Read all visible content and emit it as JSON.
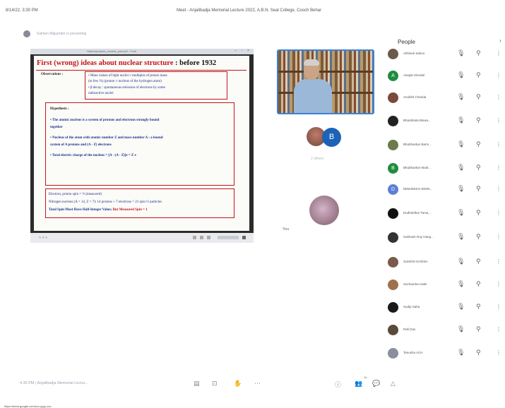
{
  "print_header": {
    "date": "8/14/22, 3:30 PM",
    "title": "Meet - Anjalibadja Memorial Lecture 2022, A.B.N. Seal College, Cooch Behar"
  },
  "presenter": {
    "label": "Sukhen Majumder is presenting"
  },
  "slide_window": {
    "titlebar": "Hadronphysics_nuclear_part.pdf - Foxit",
    "heading_red": "First (wrong) ideas about nuclear structure",
    "heading_dark": " : before 1932",
    "observations_label": "Observations :",
    "observations": [
      "• Mass values of light nuclei ≈ multiples of proton mass",
      "  (to few %)  (proton ≡ nucleus of the hydrogen atom)",
      "• β decay : spontaneous emission of electrons by some",
      "  radioactive nuclei"
    ],
    "hypothesis_label": "Hypothesis :",
    "hypothesis": [
      "• The atomic nucleus is a system of protons and electrons strongly bound",
      "  together",
      "• Nucleus of the atom with atomic number Z and mass number A : a bound",
      "  system of A protons and (A - Z) electrons",
      "• Total electric charge of the nucleus = [A - (A - Z)]e = Z e"
    ],
    "spin_lines": [
      "Electron, proton spin = ½ (measured)",
      "Nitrogen nucleus (A = 14, Z = 7): 14 protons + 7 electrons = 21 spin ½ particles"
    ],
    "spin_conclusion_dark": "Total Spin Must Have Half-Integer Value;",
    "spin_conclusion_red": " But Measured Spin = 1",
    "status_text": "✎ ✎ ✎"
  },
  "participants": {
    "others_label": "2 others",
    "b_initial": "B",
    "you_label": "You"
  },
  "people_panel": {
    "title": "People",
    "close_glyph": "›",
    "entries": [
      {
        "name": "Abhisek Sahoo",
        "initial": "",
        "color": "#6b5a4a"
      },
      {
        "name": "Aangle Mondal",
        "initial": "A",
        "color": "#1e8e3e"
      },
      {
        "name": "Anubhit Chanda",
        "initial": "",
        "color": "#7a4a3a"
      },
      {
        "name": "Bhanibrata Biswa...",
        "initial": "",
        "color": "#222222"
      },
      {
        "name": "Bhubhankar Barm...",
        "initial": "",
        "color": "#6a7a4a"
      },
      {
        "name": "Bhubhankar Maitr...",
        "initial": "B",
        "color": "#1e8e3e"
      },
      {
        "name": "DEBJEEKIA BISW...",
        "initial": "D",
        "color": "#5b7ed6"
      },
      {
        "name": "Dudheldhar Tama...",
        "initial": "",
        "color": "#111111"
      },
      {
        "name": "Subhash Roy Hang...",
        "initial": "",
        "color": "#333333"
      },
      {
        "name": "SUMON GHOSH",
        "initial": "",
        "color": "#7a5a4a"
      },
      {
        "name": "Suchandra Halei",
        "initial": "",
        "color": "#a0704a"
      },
      {
        "name": "Sudip Saha",
        "initial": "",
        "color": "#1a1a1a"
      },
      {
        "name": "Rafi Das",
        "initial": "",
        "color": "#5a4a3a"
      },
      {
        "name": "Tanusha ACH",
        "initial": "",
        "color": "#8a8fa0"
      }
    ],
    "mic_glyph": "🎙",
    "pin_glyph": "⚲",
    "more_glyph": "⋮"
  },
  "bottom_bar": {
    "meeting_info": "4:30 PM  |  Anjalibadja Memorial Lectur...",
    "participants_count": "16"
  },
  "footer_url": "https://meet.google.com/xxx-yyyy-zzz"
}
